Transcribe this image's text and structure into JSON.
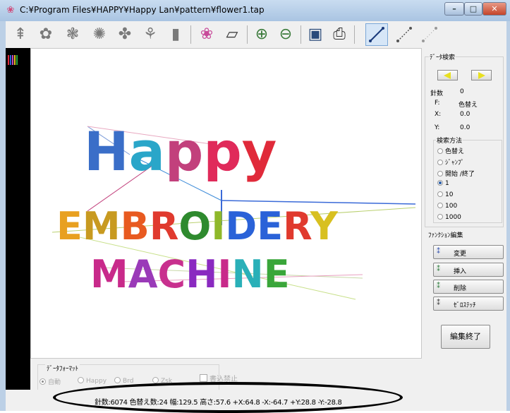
{
  "titlebar": {
    "title": "C:¥Program Files¥HAPPY¥Happy Lan¥pattern¥flower1.tap"
  },
  "toolbar": {
    "buttons": [
      "stitch-tool-icon",
      "fill-tool-icon",
      "satin-tool-icon",
      "motif-tool-icon",
      "cross-tool-icon",
      "pattern-tool-icon",
      "block-tool-icon",
      "flower-icon",
      "sheet-icon",
      "zoom-in-icon",
      "zoom-out-icon",
      "save-icon",
      "print-icon",
      "line-mode-icon",
      "dot-line-icon",
      "jump-icon"
    ]
  },
  "canvas": {
    "design": {
      "line1": "Happy",
      "line2": "EMBROIDERY",
      "line3": "MACHINE",
      "colors": [
        "#3a6ec8",
        "#2aa6c9",
        "#c2407c",
        "#e02a5a",
        "#e02a3a",
        "#e8a020",
        "#c89a20",
        "#e85a20",
        "#2e8a2e",
        "#8fb82a",
        "#2a62d8",
        "#e03a2e",
        "#d8c020",
        "#c82a8a",
        "#9a3ab8",
        "#c8308e",
        "#8a2ac0",
        "#2ab0b8",
        "#3aa63a"
      ]
    }
  },
  "data_format": {
    "legend": "ﾃﾞｰﾀﾌｫｰﾏｯﾄ",
    "options": [
      "自動",
      "Happy",
      "Brd",
      "Zsk"
    ],
    "selected": "自動",
    "write_protect": "書込禁止"
  },
  "data_search": {
    "legend": "ﾃﾞｰﾀ検索",
    "stitch_label": "針数",
    "stitch_value": "0",
    "f_label": "F:",
    "f_value": "色替え",
    "x_label": "X:",
    "x_value": "0.0",
    "y_label": "Y:",
    "y_value": "0.0"
  },
  "search_method": {
    "legend": "検索方法",
    "options": [
      "色替え",
      "ｼﾞｬﾝﾌﾟ",
      "開始 /終了",
      "1",
      "10",
      "100",
      "1000"
    ],
    "selected": "1"
  },
  "function_edit": {
    "legend": "ﾌｧﾝｸｼｮﾝ編集",
    "buttons": [
      "変更",
      "挿入",
      "削除",
      "ｾﾞﾛｽﾃｯﾁ"
    ],
    "end_button": "編集終了"
  },
  "status": {
    "text": "針数:6074  色替え数:24  幅:129.5  高さ:57.6  +X:64.8  -X:-64.7  +Y:28.8  -Y:-28.8"
  }
}
